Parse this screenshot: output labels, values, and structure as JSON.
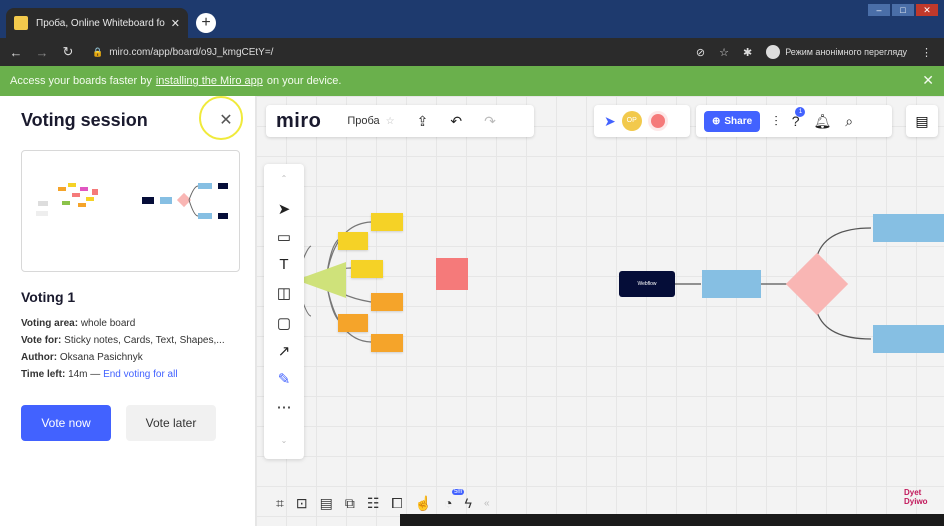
{
  "browser": {
    "tab_title": "Проба, Online Whiteboard for V",
    "url": "miro.com/app/board/o9J_kmgCEtY=/",
    "incognito_label": "Режим анонімного перегляду"
  },
  "banner": {
    "text_before": "Access your boards faster by",
    "link": "installing the Miro app",
    "text_after": "on your device."
  },
  "panel": {
    "title": "Voting session",
    "voting_name": "Voting 1",
    "area_label": "Voting area:",
    "area_value": "whole board",
    "vote_for_label": "Vote for:",
    "vote_for_value": "Sticky notes, Cards, Text, Shapes,...",
    "author_label": "Author:",
    "author_value": "Oksana Pasichnyk",
    "time_label": "Time left:",
    "time_value": "14m —",
    "end_link": "End voting for all",
    "vote_now": "Vote now",
    "vote_later": "Vote later"
  },
  "board": {
    "logo": "miro",
    "name": "Проба",
    "share": "Share",
    "avatar_initials": "OP",
    "help_badge": "1",
    "timer_badge": "5m",
    "flow_dark_label": "Webflow",
    "watermark": "Dyet Dyiwo"
  },
  "colors": {
    "accent": "#4262ff",
    "banner": "#6ab04c",
    "sticky_yellow": "#f5d226",
    "sticky_orange": "#f5a42a",
    "sticky_pink": "#f57a7a",
    "flow_navy": "#050d38",
    "flow_blue": "#86bfe3",
    "flow_diamond": "#f9b6b4"
  },
  "icons": [
    "close-icon",
    "plus-icon",
    "back-icon",
    "forward-icon",
    "reload-icon",
    "lock-icon",
    "star-icon",
    "extension-icon",
    "upload-icon",
    "undo-icon",
    "redo-icon",
    "cursor-icon",
    "settings-icon",
    "help-icon",
    "bell-icon",
    "search-icon",
    "notes-icon",
    "select-icon",
    "templates-icon",
    "text-icon",
    "sticky-note-icon",
    "comment-icon",
    "connector-icon",
    "pen-icon",
    "more-icon",
    "frame-icon",
    "embed-icon",
    "chat-icon",
    "cards-icon",
    "kanban-icon",
    "share-screen-icon",
    "vote-icon",
    "timer-icon",
    "activity-icon"
  ]
}
